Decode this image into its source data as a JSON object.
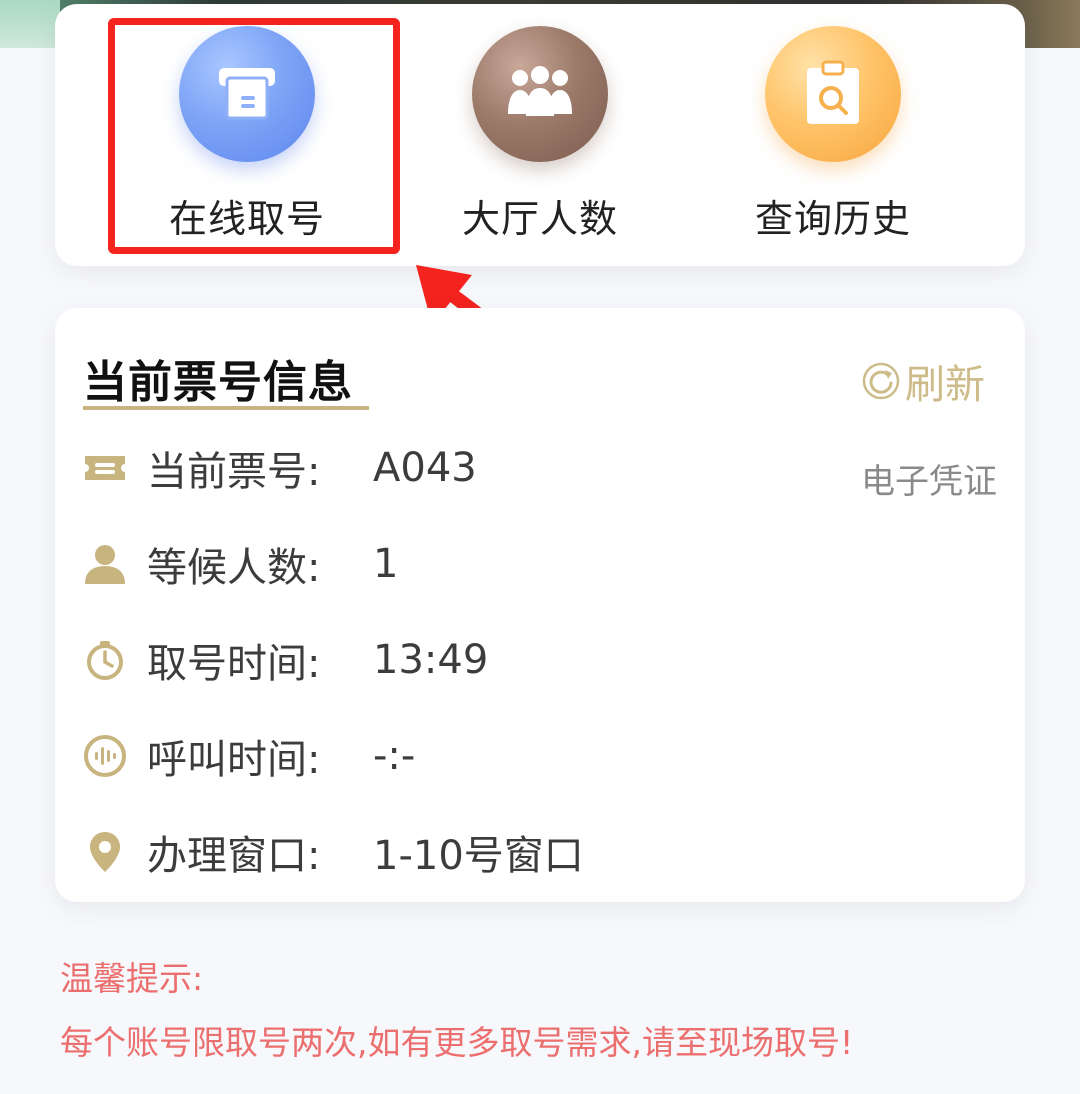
{
  "quick_actions": [
    {
      "label": "在线取号",
      "icon": "ticket-machine-icon",
      "color": "#6f97f2"
    },
    {
      "label": "大厅人数",
      "icon": "people-group-icon",
      "color": "#8d6c5d"
    },
    {
      "label": "查询历史",
      "icon": "clipboard-search-icon",
      "color": "#fbb24e"
    }
  ],
  "ticket_info": {
    "title": "当前票号信息",
    "refresh_label": "刷新",
    "voucher_label": "电子凭证",
    "rows": [
      {
        "key": "当前票号:",
        "value": "A043",
        "icon": "ticket-icon"
      },
      {
        "key": "等候人数:",
        "value": "1",
        "icon": "person-icon"
      },
      {
        "key": "取号时间:",
        "value": "13:49",
        "icon": "stopwatch-icon"
      },
      {
        "key": "呼叫时间:",
        "value": "-:-",
        "icon": "voice-call-icon"
      },
      {
        "key": "办理窗口:",
        "value": "1-10号窗口",
        "icon": "location-pin-icon"
      }
    ]
  },
  "tips": {
    "title": "温馨提示:",
    "text": "每个账号限取号两次,如有更多取号需求,请至现场取号!"
  },
  "colors": {
    "accent_gold": "#c8b47e",
    "tip_red": "#ec6f6f",
    "highlight_red": "#f4231e"
  }
}
